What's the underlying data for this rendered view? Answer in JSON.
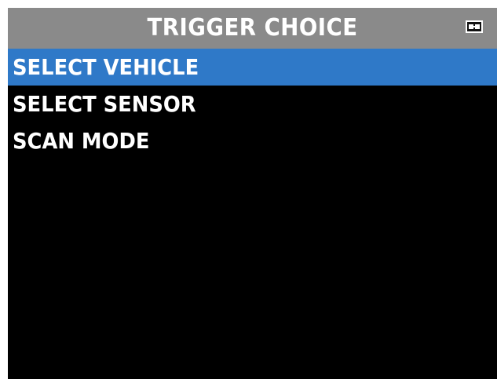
{
  "header": {
    "title": "TRIGGER CHOICE",
    "status_icon": "battery-icon"
  },
  "menu": {
    "items": [
      {
        "label": "SELECT VEHICLE",
        "selected": true
      },
      {
        "label": "SELECT SENSOR",
        "selected": false
      },
      {
        "label": "SCAN MODE",
        "selected": false
      }
    ]
  },
  "colors": {
    "title_bar": "#8a8a8a",
    "selection": "#2f79c8",
    "background": "#000000",
    "text": "#ffffff"
  }
}
